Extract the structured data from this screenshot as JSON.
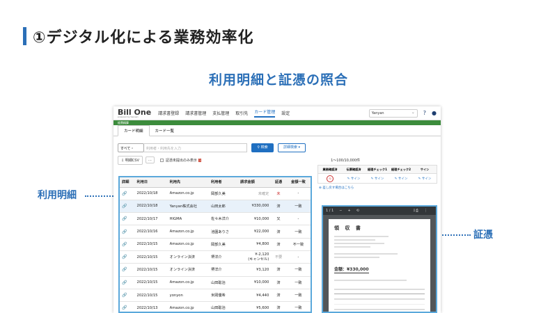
{
  "slide": {
    "title": "①デジタル化による業務効率化",
    "subtitle": "利用明細と証憑の照合",
    "left_label": "利用明細",
    "right_label": "証憑"
  },
  "app": {
    "logo": "Bill One",
    "logo_sub": "powered by Sansan",
    "nav": [
      "請求書登録",
      "請求書管理",
      "支払管理",
      "取引先",
      "カード管理",
      "設定"
    ],
    "active_nav": "カード管理",
    "company": "Yanyan",
    "section_label": "経費精算",
    "tabs": [
      "カード明細",
      "カード一覧"
    ],
    "search": {
      "select": "すべて・",
      "placeholder": "利用者・利用先を入力",
      "search_btn": "検索",
      "detail_btn": "詳細検索"
    },
    "toolbar": {
      "csv": "明細CSV",
      "more": "…",
      "unsubmitted": "証憑未提出のみ表示",
      "badge": "1",
      "pager": "1〜100/10,000件"
    },
    "table": {
      "headers": [
        "詳細",
        "利用日",
        "利用先",
        "利用者",
        "請求金額",
        "証憑",
        "金額一致"
      ],
      "rows": [
        {
          "date": "2022/10/18",
          "vendor": "Amazon.co.jp",
          "user": "岡部久美",
          "amount": "未確定",
          "voucher": "未",
          "match": "-"
        },
        {
          "date": "2022/10/18",
          "vendor": "Yanyan株式会社",
          "user": "山田太郎",
          "amount": "¥330,000",
          "voucher": "済",
          "match": "一致"
        },
        {
          "date": "2022/10/17",
          "vendor": "HIGMA",
          "user": "佐々木洋介",
          "amount": "¥10,000",
          "voucher": "又",
          "match": "-"
        },
        {
          "date": "2022/10/16",
          "vendor": "Amazon.co.jp",
          "user": "池園ありさ",
          "amount": "¥22,000",
          "voucher": "済",
          "match": "一致"
        },
        {
          "date": "2022/10/15",
          "vendor": "Amazon.co.jp",
          "user": "岡部久美",
          "amount": "¥4,800",
          "voucher": "済",
          "match": "不一致"
        },
        {
          "date": "2022/10/15",
          "vendor": "オンライン決済",
          "user": "堺洋介",
          "amount": "¥-2,120\n(キャンセル)",
          "voucher": "不要",
          "match": "-"
        },
        {
          "date": "2022/10/15",
          "vendor": "オンライン決済",
          "user": "堺洋介",
          "amount": "¥3,120",
          "voucher": "済",
          "match": "一致"
        },
        {
          "date": "2022/10/15",
          "vendor": "Amazon.co.jp",
          "user": "山田聡治",
          "amount": "¥10,000",
          "voucher": "済",
          "match": "一致"
        },
        {
          "date": "2022/10/15",
          "vendor": "yonyon",
          "user": "米岡優希",
          "amount": "¥4,440",
          "voucher": "済",
          "match": "一致"
        },
        {
          "date": "2022/10/13",
          "vendor": "Amazon.co.jp",
          "user": "山田聡治",
          "amount": "¥5,600",
          "voucher": "済",
          "match": "一致"
        }
      ]
    },
    "approval": {
      "headers": [
        "業務確認済",
        "伝票確認済",
        "経理チェック1",
        "経理チェック2",
        "サイン"
      ],
      "cells": [
        "印",
        "サイン",
        "サイン",
        "サイン",
        "サイン"
      ],
      "add_sign": "差し戻す場合はこちら"
    },
    "pdf": {
      "page": "1 / 1",
      "receipt_title": "領 収 書",
      "amount": "金額：¥330,000"
    }
  }
}
